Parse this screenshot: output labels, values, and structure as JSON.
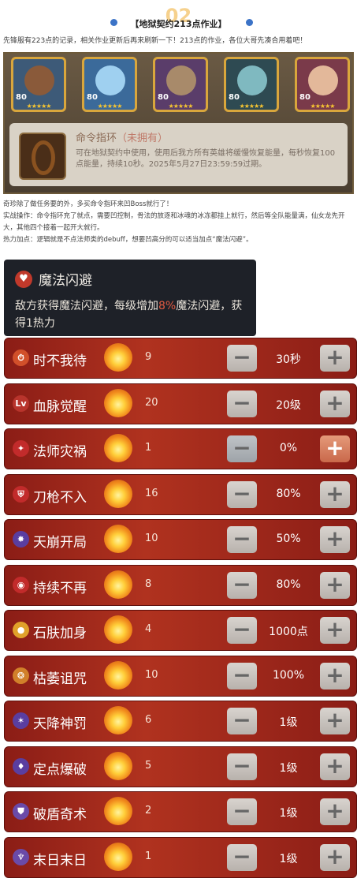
{
  "header": {
    "number": "02",
    "title": "【地狱契约213点作业】"
  },
  "intro": {
    "p1": "先锋服有223点的记录，相关作业更新后再来刷新一下！213点的作业，各位大哥先凑合用着吧！"
  },
  "heroes": [
    {
      "level": "80",
      "stars": "★★★★★"
    },
    {
      "level": "80",
      "stars": "★★★★★"
    },
    {
      "level": "80",
      "stars": "★★★★★"
    },
    {
      "level": "80",
      "stars": "★★★★★"
    },
    {
      "level": "80",
      "stars": "★★★★★"
    }
  ],
  "item": {
    "name": "命令指环",
    "owned": "（未拥有）",
    "desc": "可在地狱契约中使用，使用后我方所有英雄将缓慢恢复能量，每秒恢复100点能量，持续10秒。2025年5月27日23:59:59过期。"
  },
  "guide": {
    "l1": "奇珍除了做任务要的外，多买命令指环来凹Boss就行了！",
    "l2": "实战操作：命令指环充了就点，需要凹控制，骨法的放逐和冰魂的冰冻都挂上就行，然后等全队能量满，仙女龙先开大，其他四个接着一起开大就行。",
    "l3": "热力加点：逻辑就是不点法师类的debuff，想要凹高分的可以适当加点“魔法闪避”。"
  },
  "tooltip": {
    "name": "魔法闪避",
    "desc_a": "敌方获得魔法闪避，每级增加",
    "pct": "8%",
    "desc_b": "魔法闪避，获得1热力"
  },
  "buffs": [
    {
      "label": "时不我待",
      "count": "9",
      "value": "30秒",
      "icon": "⏱",
      "color": "#d1502a"
    },
    {
      "label": "血脉觉醒",
      "count": "20",
      "value": "20级",
      "icon": "Lv",
      "color": "#b8342c"
    },
    {
      "label": "法师灾祸",
      "count": "1",
      "value": "0%",
      "icon": "✦",
      "color": "#c22b2b"
    },
    {
      "label": "刀枪不入",
      "count": "16",
      "value": "80%",
      "icon": "⛨",
      "color": "#c22b2b"
    },
    {
      "label": "天崩开局",
      "count": "10",
      "value": "50%",
      "icon": "✸",
      "color": "#5a3ea0"
    },
    {
      "label": "持续不再",
      "count": "8",
      "value": "80%",
      "icon": "◉",
      "color": "#c22b2b"
    },
    {
      "label": "石肤加身",
      "count": "4",
      "value": "1000点",
      "icon": "●",
      "color": "#e0a12a"
    },
    {
      "label": "枯萎诅咒",
      "count": "10",
      "value": "100%",
      "icon": "❂",
      "color": "#d1802a"
    },
    {
      "label": "天降神罚",
      "count": "6",
      "value": "1级",
      "icon": "✶",
      "color": "#5a3ea0"
    },
    {
      "label": "定点爆破",
      "count": "5",
      "value": "1级",
      "icon": "♦",
      "color": "#5a3ea0"
    },
    {
      "label": "破盾奇术",
      "count": "2",
      "value": "1级",
      "icon": "⛊",
      "color": "#6a4aa8"
    },
    {
      "label": "末日末日",
      "count": "1",
      "value": "1级",
      "icon": "♆",
      "color": "#6a4aa8"
    }
  ],
  "controls": {
    "minus": "−",
    "plus": "+"
  }
}
